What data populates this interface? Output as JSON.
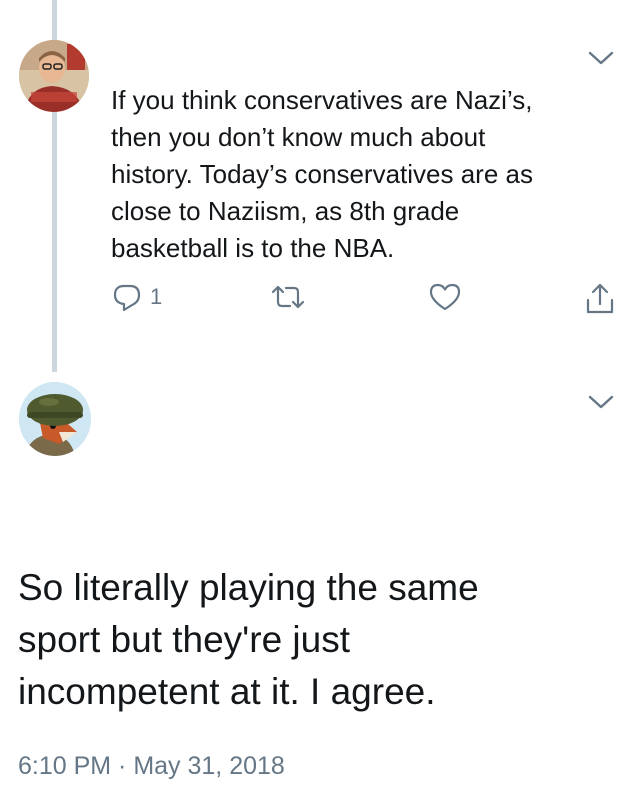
{
  "parent_tweet": {
    "text_lines": [
      "If you think conservatives are Nazi’s,",
      "then you don’t know much about",
      "history. Today’s conservatives are as",
      "close to Naziism, as 8th grade",
      "basketball is to the NBA."
    ],
    "reply_count": "1",
    "avatar_icon": "profile-photo-avatar",
    "menu_icon": "chevron-down-icon"
  },
  "reply_tweet": {
    "text_lines": [
      "So literally playing the same",
      "sport but they're just",
      "incompetent at it. I agree."
    ],
    "timestamp": "6:10 PM · May 31, 2018",
    "avatar_icon": "cartoon-fox-soldier-avatar",
    "menu_icon": "chevron-down-icon"
  },
  "colors": {
    "text": "#14171a",
    "muted": "#657786",
    "thread_line": "#ccd6dd"
  }
}
